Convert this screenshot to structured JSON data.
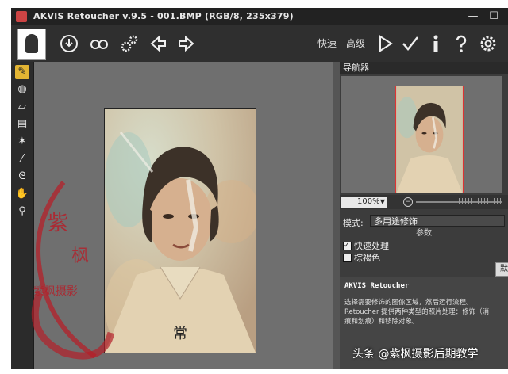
{
  "window": {
    "title": "AKVIS Retoucher v.9.5 - 001.BMP (RGB/8, 235x379)",
    "minimize_icon": "minimize-icon",
    "maximize_icon": "maximize-icon"
  },
  "toolbar": {
    "quick_label": "快速",
    "advanced_label": "高级",
    "icons": [
      "logo",
      "globe-download-icon",
      "glasses-icon",
      "gears-icon",
      "arrow-left-icon",
      "arrow-right-icon",
      "play-icon",
      "checkmark-icon",
      "info-icon",
      "help-icon",
      "settings-gear-icon"
    ]
  },
  "tools": [
    "brush-icon",
    "stamp-icon",
    "eraser-icon",
    "chisel-icon",
    "magic-wand-icon",
    "dropper-icon",
    "lasso-icon",
    "hand-icon",
    "zoom-icon"
  ],
  "navigator": {
    "title": "导航器",
    "zoom_value": "100%"
  },
  "settings": {
    "mode_label": "模式:",
    "mode_value": "多用途修饰",
    "params_title": "参数",
    "quick_process_label": "快速处理",
    "quick_process_checked": true,
    "sepia_label": "棕褐色",
    "sepia_checked": false,
    "apply_label": "默"
  },
  "info": {
    "heading": "AKVIS Retoucher",
    "line1": "选择需要修饰的图像区域，然后运行流程。",
    "line2": "Retoucher 提供两种类型的照片处理：修饰（消",
    "line3": "痕和划痕）和移除对象。"
  },
  "overlay": {
    "seal_text": "紫枫摄影",
    "watermark": "头条 @紫枫摄影后期教学"
  },
  "colors": {
    "accent_tool": "#e3b533",
    "seal_red": "#b4202a"
  }
}
